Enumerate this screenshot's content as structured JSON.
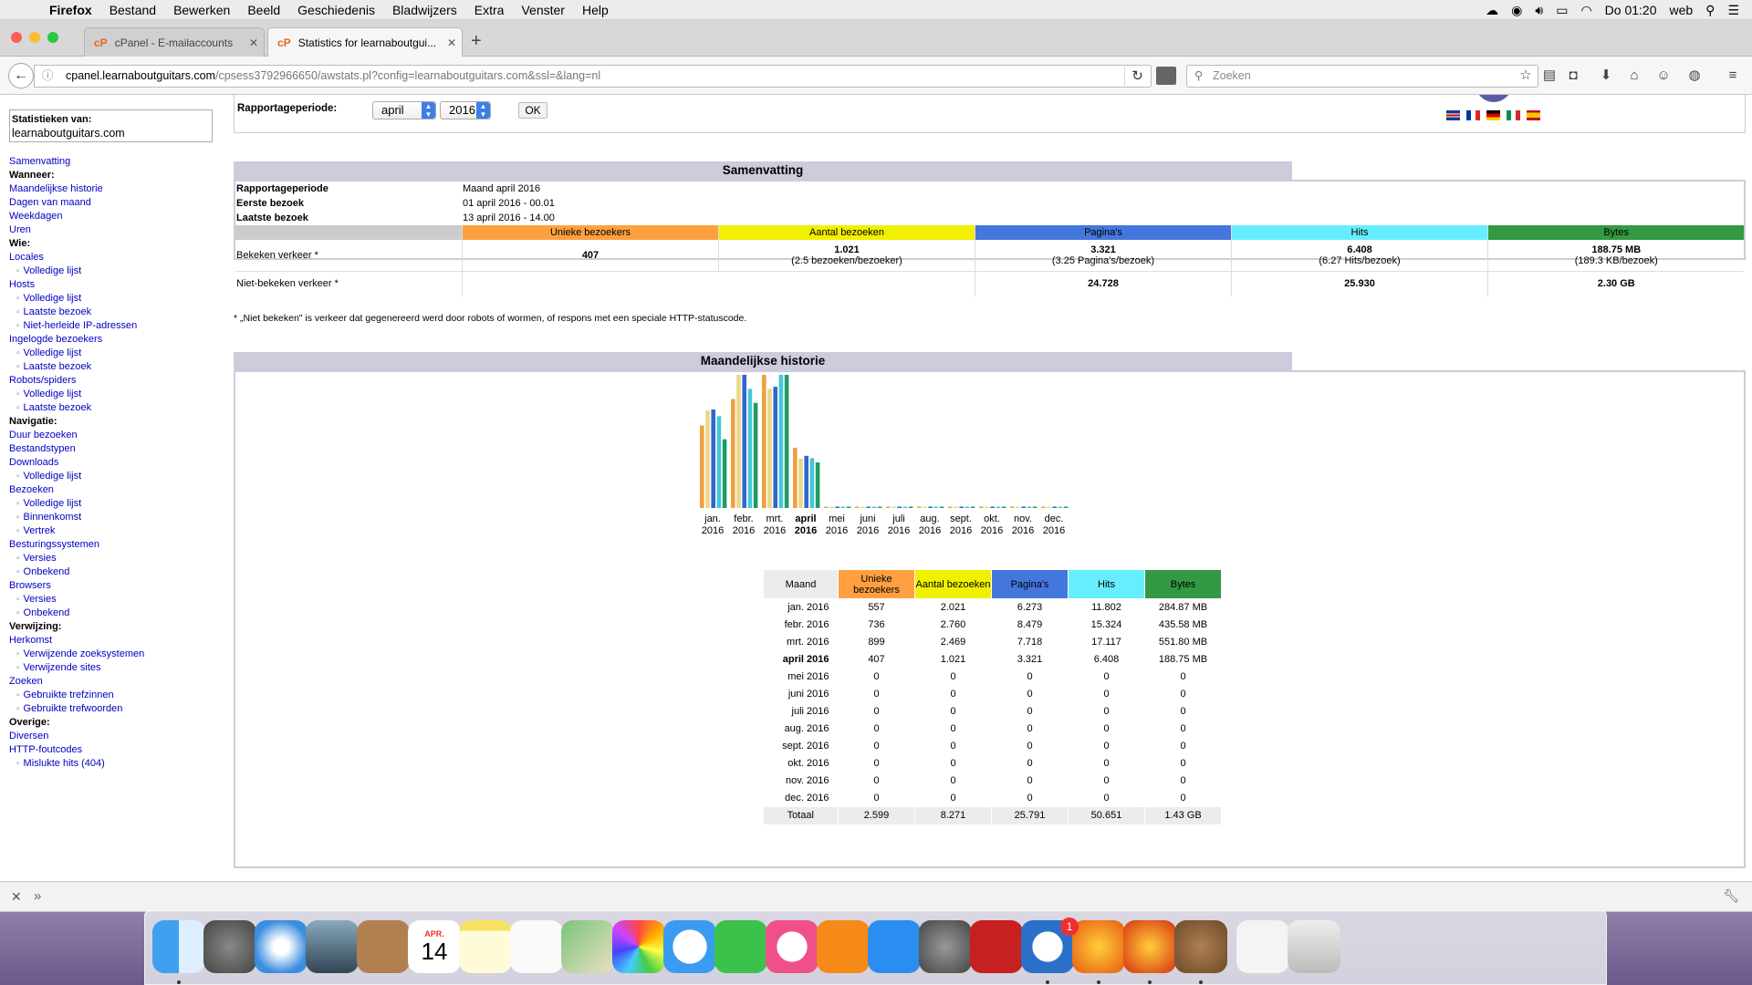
{
  "menubar": {
    "app": "Firefox",
    "items": [
      "Bestand",
      "Bewerken",
      "Beeld",
      "Geschiedenis",
      "Bladwijzers",
      "Extra",
      "Venster",
      "Help"
    ],
    "clock": "Do 01:20",
    "user": "web"
  },
  "tabs": [
    {
      "label": "cPanel - E-mailaccounts",
      "favicon": "cP",
      "active": false
    },
    {
      "label": "Statistics for learnaboutgui...",
      "favicon": "cP",
      "active": true
    }
  ],
  "navbar": {
    "url_domain": "cpanel.learnaboutguitars.com",
    "url_rest": "/cpsess3792966650/awstats.pl?config=learnaboutguitars.com&ssl=&lang=nl",
    "search_placeholder": "Zoeken"
  },
  "sidebar": {
    "stats_label": "Statistieken van:",
    "site": "learnaboutguitars.com",
    "items": [
      {
        "text": "Samenvatting",
        "type": "link"
      },
      {
        "text": "Wanneer:",
        "type": "hdr"
      },
      {
        "text": "Maandelijkse historie",
        "type": "link"
      },
      {
        "text": "Dagen van maand",
        "type": "link"
      },
      {
        "text": "Weekdagen",
        "type": "link"
      },
      {
        "text": "Uren",
        "type": "link"
      },
      {
        "text": "Wie:",
        "type": "hdr"
      },
      {
        "text": "Locales",
        "type": "link"
      },
      {
        "text": "Volledige lijst",
        "type": "sub"
      },
      {
        "text": "Hosts",
        "type": "link"
      },
      {
        "text": "Volledige lijst",
        "type": "sub"
      },
      {
        "text": "Laatste bezoek",
        "type": "sub"
      },
      {
        "text": "Niet-herleide IP-adressen",
        "type": "sub"
      },
      {
        "text": "Ingelogde bezoekers",
        "type": "link"
      },
      {
        "text": "Volledige lijst",
        "type": "sub"
      },
      {
        "text": "Laatste bezoek",
        "type": "sub"
      },
      {
        "text": "Robots/spiders",
        "type": "link"
      },
      {
        "text": "Volledige lijst",
        "type": "sub"
      },
      {
        "text": "Laatste bezoek",
        "type": "sub"
      },
      {
        "text": "Navigatie:",
        "type": "hdr"
      },
      {
        "text": "Duur bezoeken",
        "type": "link"
      },
      {
        "text": "Bestandstypen",
        "type": "link"
      },
      {
        "text": "Downloads",
        "type": "link"
      },
      {
        "text": "Volledige lijst",
        "type": "sub"
      },
      {
        "text": "Bezoeken",
        "type": "link"
      },
      {
        "text": "Volledige lijst",
        "type": "sub"
      },
      {
        "text": "Binnenkomst",
        "type": "sub"
      },
      {
        "text": "Vertrek",
        "type": "sub"
      },
      {
        "text": "Besturingssystemen",
        "type": "link"
      },
      {
        "text": "Versies",
        "type": "sub"
      },
      {
        "text": "Onbekend",
        "type": "sub"
      },
      {
        "text": "Browsers",
        "type": "link"
      },
      {
        "text": "Versies",
        "type": "sub"
      },
      {
        "text": "Onbekend",
        "type": "sub"
      },
      {
        "text": "Verwijzing:",
        "type": "hdr"
      },
      {
        "text": "Herkomst",
        "type": "link"
      },
      {
        "text": "Verwijzende zoeksystemen",
        "type": "sub"
      },
      {
        "text": "Verwijzende sites",
        "type": "sub"
      },
      {
        "text": "Zoeken",
        "type": "link"
      },
      {
        "text": "Gebruikte trefzinnen",
        "type": "sub"
      },
      {
        "text": "Gebruikte trefwoorden",
        "type": "sub"
      },
      {
        "text": "Overige:",
        "type": "hdr"
      },
      {
        "text": "Diversen",
        "type": "link"
      },
      {
        "text": "HTTP-foutcodes",
        "type": "link"
      },
      {
        "text": "Mislukte hits (404)",
        "type": "sub"
      }
    ]
  },
  "period": {
    "label": "Rapportageperiode:",
    "month": "april",
    "year": "2016",
    "ok": "OK"
  },
  "summary": {
    "title": "Samenvatting",
    "rows": [
      {
        "label": "Rapportageperiode",
        "value": "Maand april 2016"
      },
      {
        "label": "Eerste bezoek",
        "value": "01 april 2016 - 00.01"
      },
      {
        "label": "Laatste bezoek",
        "value": "13 april 2016 - 14.00"
      }
    ],
    "headers": [
      "Unieke bezoekers",
      "Aantal bezoeken",
      "Pagina's",
      "Hits",
      "Bytes"
    ],
    "header_colors": [
      "#ffa040",
      "#f0f000",
      "#4477dd",
      "#66eeff",
      "#339944"
    ],
    "viewed_label": "Bekeken verkeer *",
    "viewed": [
      {
        "main": "407",
        "sub": ""
      },
      {
        "main": "1.021",
        "sub": "(2.5 bezoeken/bezoeker)"
      },
      {
        "main": "3.321",
        "sub": "(3.25 Pagina's/bezoek)"
      },
      {
        "main": "6.408",
        "sub": "(6.27 Hits/bezoek)"
      },
      {
        "main": "188.75 MB",
        "sub": "(189.3 KB/bezoek)"
      }
    ],
    "notviewed_label": "Niet-bekeken verkeer *",
    "notviewed": [
      "",
      "",
      "24.728",
      "25.930",
      "2.30 GB"
    ],
    "footnote": "* „Niet bekeken\" is verkeer dat gegenereerd werd door robots of wormen, of respons met een speciale HTTP-statuscode."
  },
  "history": {
    "title": "Maandelijkse historie",
    "table_headers": [
      "Maand",
      "Unieke bezoekers",
      "Aantal bezoeken",
      "Pagina's",
      "Hits",
      "Bytes"
    ],
    "rows": [
      [
        "jan. 2016",
        "557",
        "2.021",
        "6.273",
        "11.802",
        "284.87 MB"
      ],
      [
        "febr. 2016",
        "736",
        "2.760",
        "8.479",
        "15.324",
        "435.58 MB"
      ],
      [
        "mrt. 2016",
        "899",
        "2.469",
        "7.718",
        "17.117",
        "551.80 MB"
      ],
      [
        "april 2016",
        "407",
        "1.021",
        "3.321",
        "6.408",
        "188.75 MB"
      ],
      [
        "mei 2016",
        "0",
        "0",
        "0",
        "0",
        "0"
      ],
      [
        "juni 2016",
        "0",
        "0",
        "0",
        "0",
        "0"
      ],
      [
        "juli 2016",
        "0",
        "0",
        "0",
        "0",
        "0"
      ],
      [
        "aug. 2016",
        "0",
        "0",
        "0",
        "0",
        "0"
      ],
      [
        "sept. 2016",
        "0",
        "0",
        "0",
        "0",
        "0"
      ],
      [
        "okt. 2016",
        "0",
        "0",
        "0",
        "0",
        "0"
      ],
      [
        "nov. 2016",
        "0",
        "0",
        "0",
        "0",
        "0"
      ],
      [
        "dec. 2016",
        "0",
        "0",
        "0",
        "0",
        "0"
      ]
    ],
    "total": [
      "Totaal",
      "2.599",
      "8.271",
      "25.791",
      "50.651",
      "1.43 GB"
    ],
    "current_month_index": 3
  },
  "chart_data": {
    "type": "bar",
    "categories": [
      "jan. 2016",
      "febr. 2016",
      "mrt. 2016",
      "april 2016",
      "mei 2016",
      "juni 2016",
      "juli 2016",
      "aug. 2016",
      "sept. 2016",
      "okt. 2016",
      "nov. 2016",
      "dec. 2016"
    ],
    "tick_labels": [
      [
        "jan.",
        "2016"
      ],
      [
        "febr.",
        "2016"
      ],
      [
        "mrt.",
        "2016"
      ],
      [
        "april",
        "2016"
      ],
      [
        "mei",
        "2016"
      ],
      [
        "juni",
        "2016"
      ],
      [
        "juli",
        "2016"
      ],
      [
        "aug.",
        "2016"
      ],
      [
        "sept.",
        "2016"
      ],
      [
        "okt.",
        "2016"
      ],
      [
        "nov.",
        "2016"
      ],
      [
        "dec.",
        "2016"
      ]
    ],
    "series": [
      {
        "name": "Unieke bezoekers",
        "color": "#f0a040",
        "values": [
          557,
          736,
          899,
          407,
          0,
          0,
          0,
          0,
          0,
          0,
          0,
          0
        ]
      },
      {
        "name": "Aantal bezoeken",
        "color": "#e8d888",
        "values": [
          2021,
          2760,
          2469,
          1021,
          0,
          0,
          0,
          0,
          0,
          0,
          0,
          0
        ]
      },
      {
        "name": "Pagina's",
        "color": "#3366cc",
        "values": [
          6273,
          8479,
          7718,
          3321,
          0,
          0,
          0,
          0,
          0,
          0,
          0,
          0
        ]
      },
      {
        "name": "Hits",
        "color": "#44c8d8",
        "values": [
          11802,
          15324,
          17117,
          6408,
          0,
          0,
          0,
          0,
          0,
          0,
          0,
          0
        ]
      },
      {
        "name": "Bytes",
        "color": "#229966",
        "values_mb": [
          284.87,
          435.58,
          551.8,
          188.75,
          0,
          0,
          0,
          0,
          0,
          0,
          0,
          0
        ]
      }
    ]
  },
  "dock": {
    "items": [
      "finder-icon",
      "launchpad-icon",
      "safari-icon",
      "mail-icon",
      "contacts-icon",
      "calendar-icon",
      "notes-icon",
      "reminders-icon",
      "maps-icon",
      "photos-icon",
      "messages-icon",
      "facetime-icon",
      "itunes-icon",
      "ibooks-icon",
      "appstore-icon",
      "system-preferences-icon",
      "filezilla-icon",
      "openoffice-icon",
      "firefox-icon",
      "firefox-dev-icon",
      "gimp-icon",
      "document-icon",
      "trash-icon"
    ],
    "calendar_month": "APR.",
    "calendar_day": "14",
    "appstore_badge": "1"
  }
}
